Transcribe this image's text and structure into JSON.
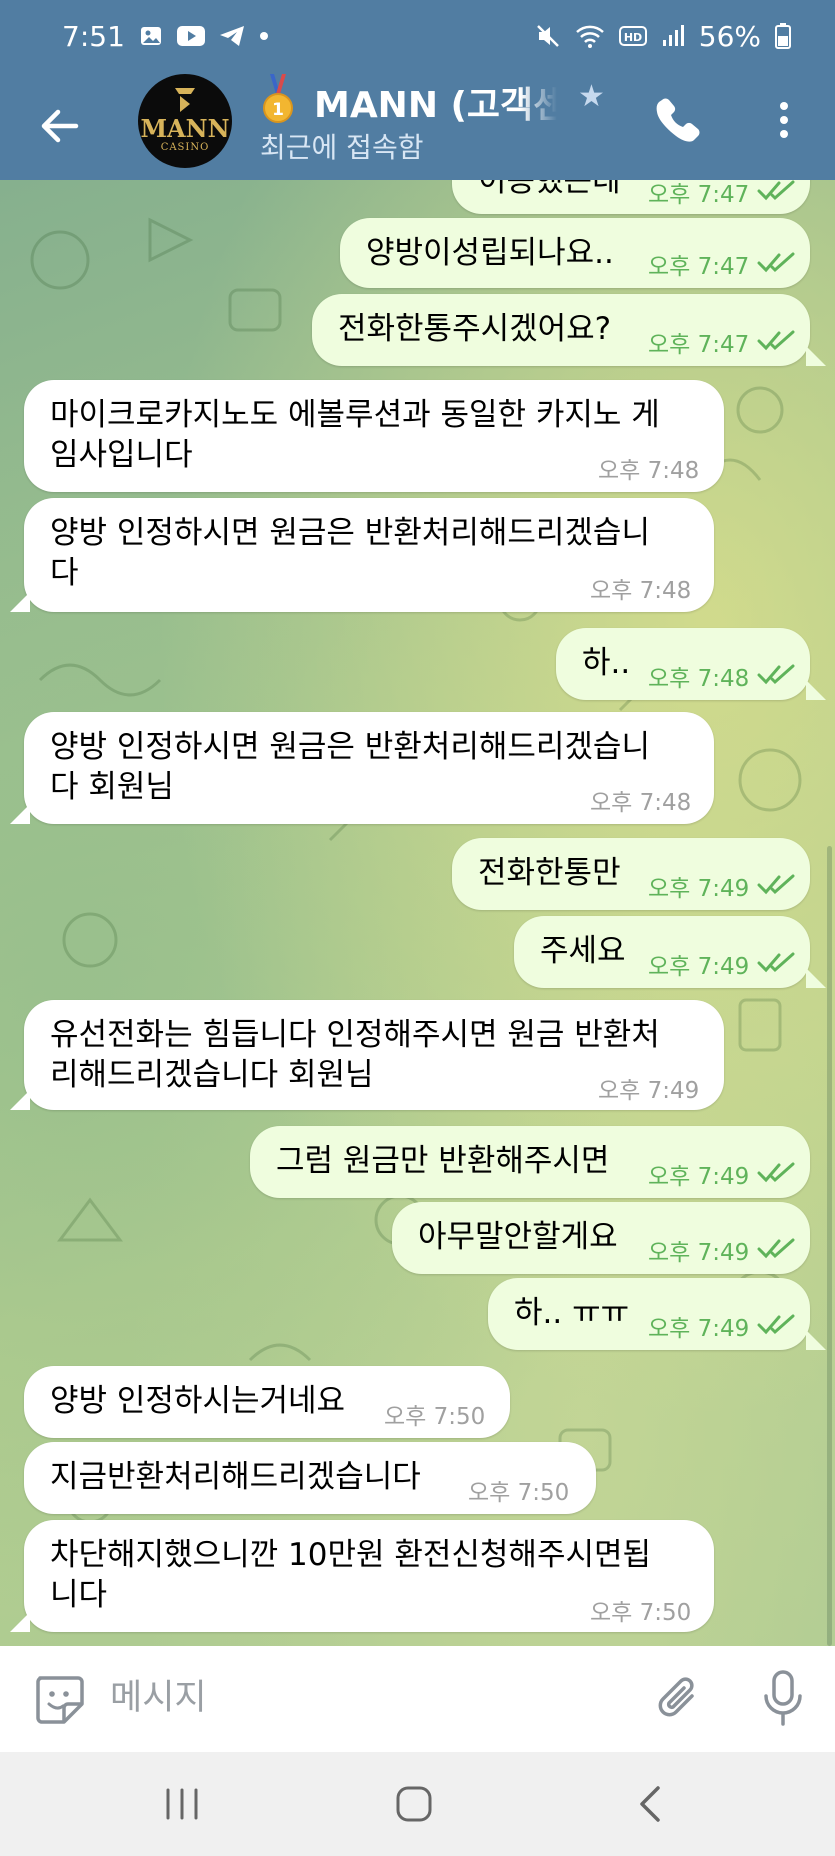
{
  "status_bar": {
    "time": "7:51",
    "battery": "56%",
    "left_icons": [
      "gallery-icon",
      "youtube-icon",
      "telegram-icon",
      "dot-icon"
    ],
    "right_icons": [
      "mute-icon",
      "wifi-icon",
      "hd-icon",
      "signal-icon",
      "battery-icon"
    ]
  },
  "header": {
    "title": "MANN (고객센",
    "subtitle": "최근에 접속함",
    "avatar_text": "MANN",
    "avatar_subtext": "CASINO"
  },
  "messages": [
    {
      "dir": "out",
      "text": "이용했는데",
      "time": "오후 7:47",
      "read": true
    },
    {
      "dir": "out",
      "text": "양방이성립되나요..",
      "time": "오후 7:47",
      "read": true
    },
    {
      "dir": "out",
      "text": "전화한통주시겠어요?",
      "time": "오후 7:47",
      "read": true
    },
    {
      "dir": "in",
      "line1": "마이크로카지노도 에볼루션과 동일한 카지노 게",
      "line2": "임사입니다",
      "time": "오후 7:48"
    },
    {
      "dir": "in",
      "line1": "양방 인정하시면 원금은 반환처리해드리겠습니",
      "line2": "다",
      "time": "오후 7:48"
    },
    {
      "dir": "out",
      "text": "하..",
      "time": "오후 7:48",
      "read": true
    },
    {
      "dir": "in",
      "line1": "양방 인정하시면 원금은 반환처리해드리겠습니",
      "line2": "다 회원님",
      "time": "오후 7:48"
    },
    {
      "dir": "out",
      "text": "전화한통만",
      "time": "오후 7:49",
      "read": true
    },
    {
      "dir": "out",
      "text": "주세요",
      "time": "오후 7:49",
      "read": true
    },
    {
      "dir": "in",
      "line1": "유선전화는 힘듭니다 인정해주시면 원금 반환처",
      "line2": "리해드리겠습니다 회원님",
      "time": "오후 7:49"
    },
    {
      "dir": "out",
      "text": "그럼 원금만 반환해주시면",
      "time": "오후 7:49",
      "read": true
    },
    {
      "dir": "out",
      "text": "아무말안할게요",
      "time": "오후 7:49",
      "read": true
    },
    {
      "dir": "out",
      "text": "하.. ㅠㅠ",
      "time": "오후 7:49",
      "read": true
    },
    {
      "dir": "in",
      "text": "양방 인정하시는거네요",
      "time": "오후 7:50"
    },
    {
      "dir": "in",
      "text": "지금반환처리해드리겠습니다",
      "time": "오후 7:50"
    },
    {
      "dir": "in",
      "line1": "차단해지했으니깐 10만원 환전신청해주시면됩",
      "line2": "니다",
      "time": "오후 7:50"
    }
  ],
  "composer": {
    "placeholder": "메시지",
    "icons": [
      "sticker-icon",
      "paperclip-icon",
      "microphone-icon"
    ]
  },
  "colors": {
    "header": "#517da2",
    "incoming_bubble": "#ffffff",
    "outgoing_bubble": "#effdde",
    "outgoing_time": "#5fb35a",
    "incoming_time": "#a0a0a0"
  }
}
